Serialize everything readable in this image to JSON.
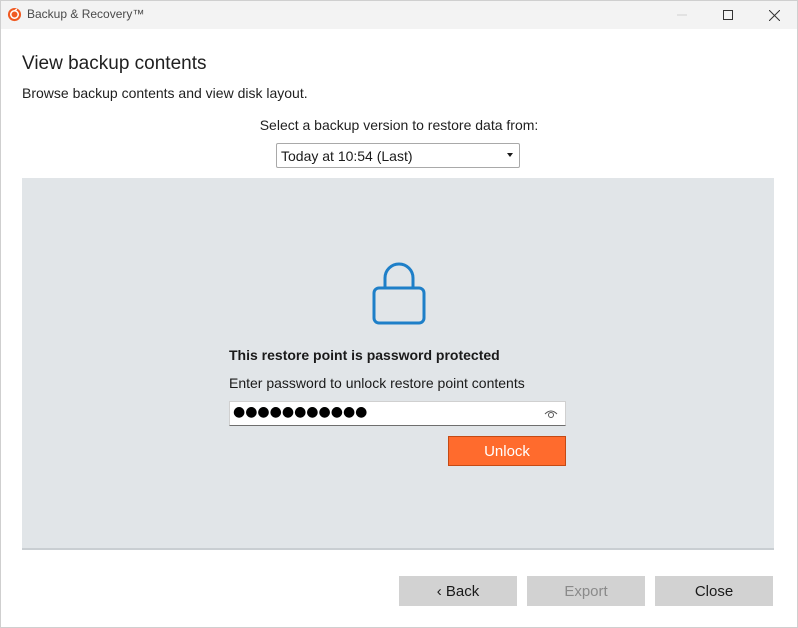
{
  "window": {
    "title": "Backup & Recovery™",
    "app_icon": "backup-recovery-logo",
    "controls": [
      "minimize-icon",
      "maximize-icon",
      "close-icon"
    ]
  },
  "header": {
    "title": "View backup contents",
    "subtitle": "Browse backup contents and view disk layout."
  },
  "version_selector": {
    "label": "Select a backup version to restore data from:",
    "selected": "Today at 10:54 (Last)"
  },
  "lock_panel": {
    "icon": "lock-icon",
    "title": "This restore point is password protected",
    "description": "Enter password to unlock restore point contents",
    "password_masked": "●●●●●●●●●●●",
    "reveal_icon": "eye-icon",
    "unlock_label": "Unlock"
  },
  "footer": {
    "back_label": "‹ Back",
    "export_label": "Export",
    "close_label": "Close"
  },
  "colors": {
    "accent": "#ff6b2d",
    "lock_blue": "#1e7fc8",
    "panel_bg": "#e1e5e8",
    "button_bg": "#d2d2d2"
  }
}
